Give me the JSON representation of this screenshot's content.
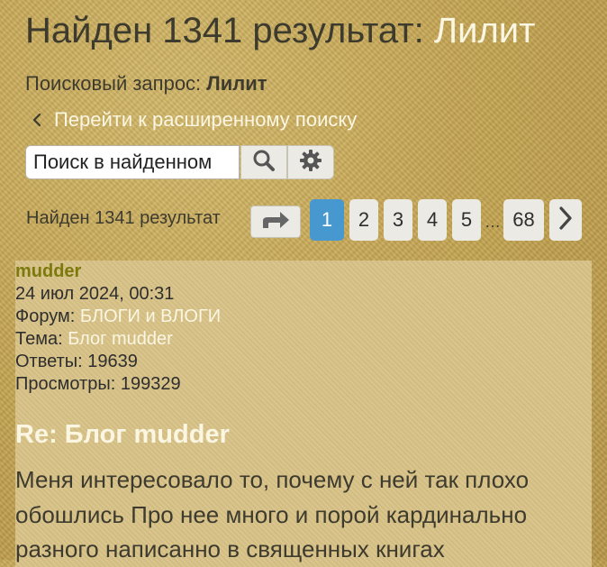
{
  "header": {
    "title_prefix": "Найден 1341 результат:",
    "title_query": "Лилит",
    "query_label": "Поисковый запрос:",
    "query_value": "Лилит",
    "advanced_link": "Перейти к расширенному поиску"
  },
  "search": {
    "value": "Поиск в найденном",
    "placeholder": "Поиск в найденном"
  },
  "pagination": {
    "count_text": "Найден 1341 результат",
    "pages": [
      "1",
      "2",
      "3",
      "4",
      "5"
    ],
    "active_page": "1",
    "ellipsis": "…",
    "last_page": "68"
  },
  "icons": {
    "back": "chevron-left-icon",
    "search": "magnifier-icon",
    "settings": "gear-icon",
    "jump": "jump-to-page-icon",
    "next": "chevron-right-icon"
  },
  "colors": {
    "accent_link": "#fbf6e2",
    "author": "#7c7a0c",
    "active_page": "#4798cf",
    "background": "#c4a551",
    "post_background": "#d8c287"
  },
  "post": {
    "author": "mudder",
    "date": "24 июл 2024, 00:31",
    "forum_label": "Форум:",
    "forum_value": "БЛОГИ и ВЛОГИ",
    "topic_label": "Тема:",
    "topic_value": "Блог mudder",
    "replies_label": "Ответы:",
    "replies_value": "19639",
    "views_label": "Просмотры:",
    "views_value": "199329",
    "title": "Re: Блог mudder",
    "body": "Меня интересовало то, почему с ней так плохо обошлись Про нее много и порой кардинально разного написанно в священных книгах"
  }
}
